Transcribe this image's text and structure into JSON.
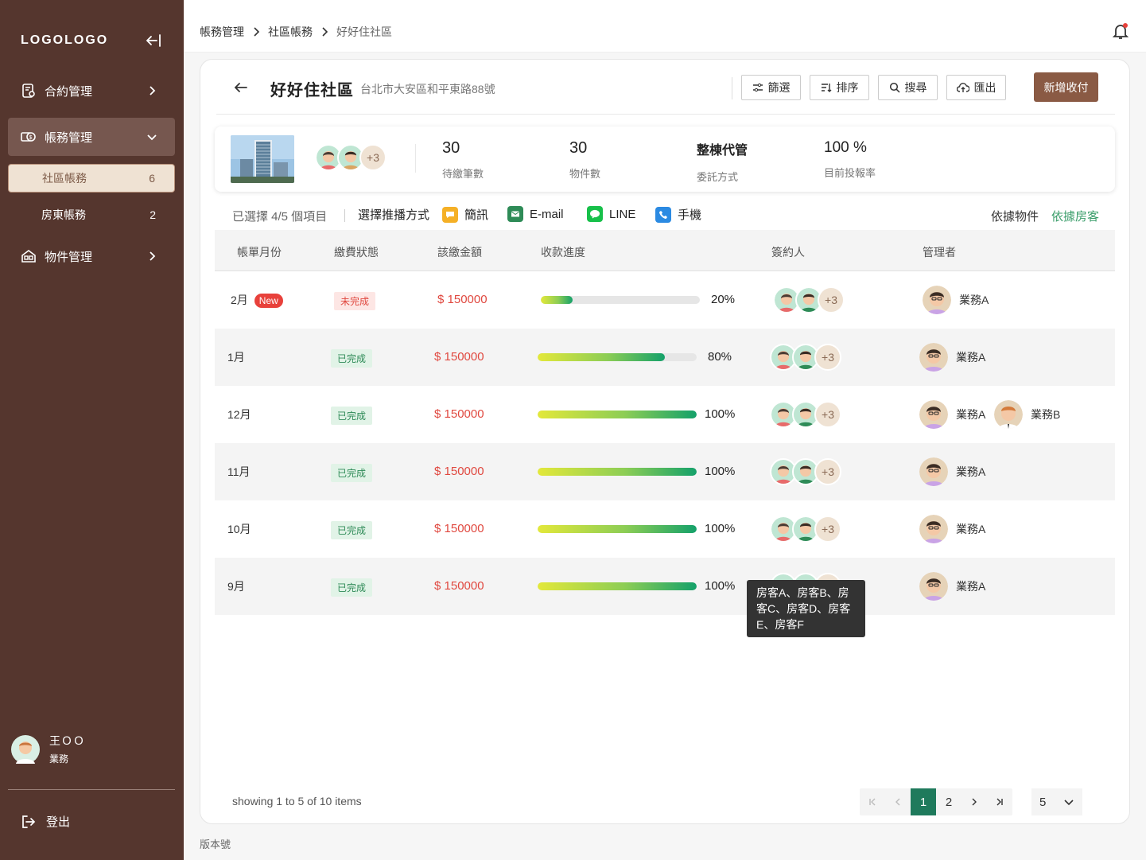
{
  "app": {
    "logo": "LOGOLOGO"
  },
  "sidebar": {
    "items": [
      {
        "label": "合約管理"
      },
      {
        "label": "帳務管理"
      },
      {
        "label": "物件管理"
      }
    ],
    "sub_items": [
      {
        "label": "社區帳務",
        "count": "6"
      },
      {
        "label": "房東帳務",
        "count": "2"
      }
    ],
    "user": {
      "name": "王ＯＯ",
      "role": "業務"
    },
    "logout": "登出"
  },
  "header": {
    "breadcrumb": [
      "帳務管理",
      "社區帳務",
      "好好住社區"
    ]
  },
  "page": {
    "title": "好好住社區",
    "address": "台北市大安區和平東路88號",
    "toolbar": {
      "filter": "篩選",
      "sort": "排序",
      "search": "搜尋",
      "export": "匯出",
      "add": "新增收付"
    }
  },
  "info": {
    "avatars_more": "+3",
    "stats": [
      {
        "value": "30",
        "label": "待繳筆數"
      },
      {
        "value": "30",
        "label": "物件數"
      },
      {
        "value": "整棟代管",
        "label": "委託方式"
      },
      {
        "value": "100 %",
        "label": "目前投報率"
      }
    ]
  },
  "filters": {
    "selected": "已選擇 4/5 個項目",
    "channel_label": "選擇推播方式",
    "channels": [
      "簡訊",
      "E-mail",
      "LINE",
      "手機"
    ],
    "by_object": "依據物件",
    "by_tenant": "依據房客"
  },
  "table": {
    "headers": [
      "帳單月份",
      "繳費狀態",
      "該繳金額",
      "收款進度",
      "簽約人",
      "管理者"
    ],
    "rows": [
      {
        "month": "2月",
        "badge": "New",
        "status": "未完成",
        "amount": "$ 150000",
        "progress": 20,
        "progress_label": "20%",
        "signers_more": "+3",
        "managers": [
          "業務A"
        ]
      },
      {
        "month": "1月",
        "status": "已完成",
        "amount": "$ 150000",
        "progress": 80,
        "progress_label": "80%",
        "signers_more": "+3",
        "managers": [
          "業務A"
        ]
      },
      {
        "month": "12月",
        "status": "已完成",
        "amount": "$ 150000",
        "progress": 100,
        "progress_label": "100%",
        "signers_more": "+3",
        "managers": [
          "業務A",
          "業務B"
        ]
      },
      {
        "month": "11月",
        "status": "已完成",
        "amount": "$ 150000",
        "progress": 100,
        "progress_label": "100%",
        "signers_more": "+3",
        "managers": [
          "業務A"
        ]
      },
      {
        "month": "10月",
        "status": "已完成",
        "amount": "$ 150000",
        "progress": 100,
        "progress_label": "100%",
        "signers_more": "+3",
        "managers": [
          "業務A"
        ]
      },
      {
        "month": "9月",
        "status": "已完成",
        "amount": "$ 150000",
        "progress": 100,
        "progress_label": "100%",
        "signers_more": "",
        "managers": [
          "業務A"
        ]
      }
    ],
    "tooltip": "房客A、房客B、房客C、房客D、房客E、房客F"
  },
  "pagination": {
    "showing": "showing 1 to 5 of 10 items",
    "pages": [
      "1",
      "2"
    ],
    "current": "1",
    "page_size": "5"
  },
  "footer": {
    "version": "版本號"
  },
  "colors": {
    "sidebar": "#55362e",
    "accent": "#8a5a44",
    "success": "#1f7a5c",
    "danger": "#e0483f"
  }
}
